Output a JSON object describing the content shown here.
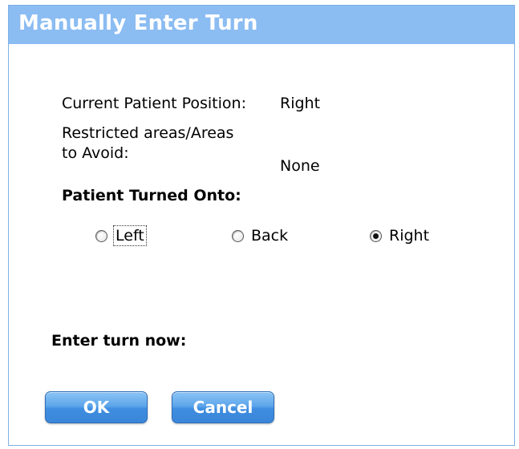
{
  "dialog": {
    "title": "Manually Enter Turn"
  },
  "info": {
    "current_position_label": "Current Patient Position:",
    "current_position_value": "Right",
    "restricted_label_line1": "Restricted areas/Areas",
    "restricted_label_line2": "to Avoid:",
    "restricted_value": "None"
  },
  "turned_onto": {
    "heading": "Patient Turned Onto:",
    "options": [
      {
        "label": "Left",
        "checked": false,
        "focused": true
      },
      {
        "label": "Back",
        "checked": false,
        "focused": false
      },
      {
        "label": "Right",
        "checked": true,
        "focused": false
      }
    ]
  },
  "enter_turn": {
    "label": "Enter turn now:"
  },
  "buttons": {
    "ok_label": "OK",
    "cancel_label": "Cancel"
  },
  "colors": {
    "titlebar": "#8bbcf2",
    "button": "#4a95e3"
  }
}
